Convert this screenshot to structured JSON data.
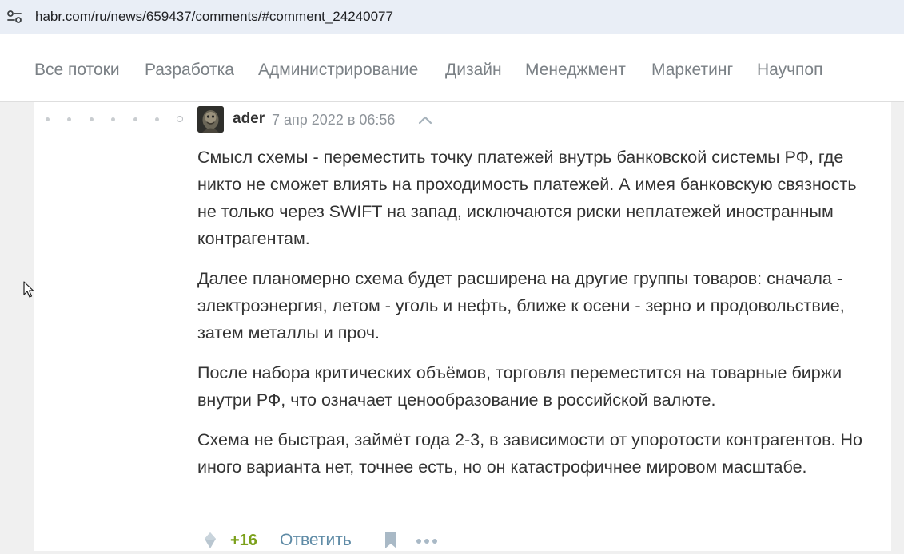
{
  "browser": {
    "url": "habr.com/ru/news/659437/comments/#comment_24240077"
  },
  "nav": {
    "items": [
      {
        "label": "Все потоки"
      },
      {
        "label": "Разработка"
      },
      {
        "label": "Администрирование"
      },
      {
        "label": "Дизайн"
      },
      {
        "label": "Менеджмент"
      },
      {
        "label": "Маркетинг"
      },
      {
        "label": "Научпоп"
      }
    ]
  },
  "comment": {
    "author": "ader",
    "datetime": "7 апр 2022 в 06:56",
    "paragraphs": [
      "Смысл схемы - переместить точку платежей внутрь банковской системы РФ, где никто не сможет влиять на проходимость платежей. А имея банковскую связность не только через SWIFT на запад, исключаются риски неплатежей иностранным контрагентам.",
      "Далее планомерно схема будет расширена на другие группы товаров: сначала - электроэнергия, летом - уголь и нефть, ближе к осени - зерно и продовольствие, затем металлы и проч.",
      "После набора критических объёмов, торговля переместится на товарные биржи внутри РФ, что означает ценообразование в российской валюте.",
      "Схема не быстрая, займёт года 2-3, в зависимости от упоротости контрагентов. Но иного варианта нет, точнее есть, но он катастрофичнее мировом масштабе."
    ],
    "score": "+16",
    "reply_label": "Ответить"
  },
  "icons": {
    "site_info": "tune-icon",
    "collapse": "chevron-up-icon",
    "vote": "vote-icon",
    "bookmark": "bookmark-icon",
    "more": "more-dots-icon"
  },
  "colors": {
    "score": "#7ba01a",
    "link": "#5f8ba6",
    "nav_text": "#7b8186"
  }
}
